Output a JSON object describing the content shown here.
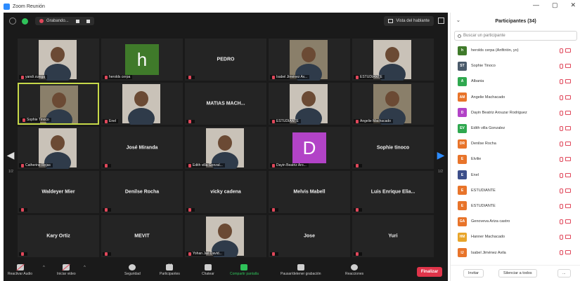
{
  "window": {
    "title": "Zoom Reunión",
    "controls": [
      "—",
      "▢",
      "✕"
    ]
  },
  "topbar": {
    "recording_label": "Grabando...",
    "speaker_view_label": "Vista del hablante"
  },
  "tiles": [
    {
      "name": "",
      "label": "yandi zuniga",
      "kind": "video"
    },
    {
      "name": "",
      "label": "herolds cerpa",
      "kind": "avatar",
      "letter": "h",
      "color": "#3f7a2a"
    },
    {
      "name": "PEDRO",
      "label": "",
      "kind": "name"
    },
    {
      "name": "",
      "label": "Isabel Jiménez Av...",
      "kind": "video"
    },
    {
      "name": "",
      "label": "ESTUDIANTE",
      "kind": "video"
    },
    {
      "name": "",
      "label": "Sophie Tinoco",
      "kind": "video",
      "active": true
    },
    {
      "name": "",
      "label": "Enel",
      "kind": "video"
    },
    {
      "name": "MATIAS MACH...",
      "label": "",
      "kind": "name"
    },
    {
      "name": "",
      "label": "ESTUDIANTE",
      "kind": "video"
    },
    {
      "name": "",
      "label": "Angelie Machacado",
      "kind": "video"
    },
    {
      "name": "",
      "label": "Catherine Rojas",
      "kind": "video"
    },
    {
      "name": "José Miranda",
      "label": "",
      "kind": "name"
    },
    {
      "name": "",
      "label": "Edith villa Gonzal...",
      "kind": "video"
    },
    {
      "name": "",
      "label": "Dayin Beatriz Aro...",
      "kind": "avatar",
      "letter": "D",
      "color": "#b243c7"
    },
    {
      "name": "Sophie tinoco",
      "label": "",
      "kind": "name"
    },
    {
      "name": "Waldeyer Mier",
      "label": "",
      "kind": "name"
    },
    {
      "name": "Denilse Rocha",
      "label": "",
      "kind": "name"
    },
    {
      "name": "vicky cadena",
      "label": "",
      "kind": "name"
    },
    {
      "name": "Melvis Mabell",
      "label": "",
      "kind": "name"
    },
    {
      "name": "Luis Enrique Elia...",
      "label": "",
      "kind": "name"
    },
    {
      "name": "Kary Ortiz",
      "label": "",
      "kind": "name"
    },
    {
      "name": "MEVIT",
      "label": "",
      "kind": "name"
    },
    {
      "name": "",
      "label": "Yohan Jari David...",
      "kind": "video"
    },
    {
      "name": "Jose",
      "label": "",
      "kind": "name"
    },
    {
      "name": "Yuri",
      "label": "",
      "kind": "name"
    }
  ],
  "pagination": {
    "left": "1/2",
    "right": "1/2"
  },
  "toolbar": {
    "unmute": "Reactivar Audio",
    "start_video": "Iniciar video",
    "security": "Seguridad",
    "participants": "Participantes",
    "participants_count": "34",
    "chat": "Chatear",
    "share": "Compartir pantalla",
    "pause_recording": "Pausar/detener grabación",
    "reactions": "Reacciones",
    "end": "Finalizar"
  },
  "panel": {
    "title": "Participantes (34)",
    "search_placeholder": "Buscar un participante",
    "invite": "Invitar",
    "mute_all": "Silenciar a todos",
    "more": "...",
    "participants": [
      {
        "initials": "h",
        "name": "herolds cerpa (Anfitrión, yo)",
        "color": "#3f7a2a"
      },
      {
        "initials": "ST",
        "name": "Sophie Tinoco",
        "color": "#4a5a6a"
      },
      {
        "initials": "A",
        "name": "Albania",
        "color": "#2fa84f"
      },
      {
        "initials": "AM",
        "name": "Angelie Machacado",
        "color": "#e8742a"
      },
      {
        "initials": "D",
        "name": "Dayin Beatriz Arouzar Rodriguez",
        "color": "#b243c7"
      },
      {
        "initials": "EV",
        "name": "Edith villa Gonzalez",
        "color": "#2fa84f"
      },
      {
        "initials": "DR",
        "name": "Denilse Rocha",
        "color": "#e8742a"
      },
      {
        "initials": "E",
        "name": "Elvilie",
        "color": "#e8742a"
      },
      {
        "initials": "E",
        "name": "Enel",
        "color": "#3d4f8a"
      },
      {
        "initials": "E",
        "name": "ESTUDIANTE",
        "color": "#e8742a"
      },
      {
        "initials": "E",
        "name": "ESTUDIANTE",
        "color": "#e8742a"
      },
      {
        "initials": "GA",
        "name": "Genoveva Ariza castro",
        "color": "#e8742a"
      },
      {
        "initials": "HM",
        "name": "Hanner Machacado",
        "color": "#e8a52a"
      },
      {
        "initials": "IJ",
        "name": "Isabel Jiménez Avila",
        "color": "#e8742a"
      }
    ]
  }
}
